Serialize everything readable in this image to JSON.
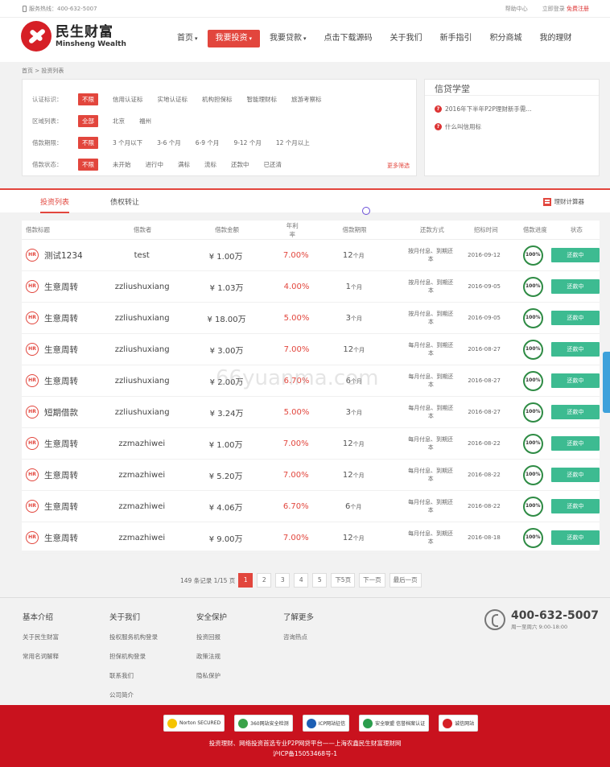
{
  "topbar": {
    "hotline": "服务热线：400-632-5007",
    "help": "帮助中心",
    "login": "立即登录",
    "register": "免费注册"
  },
  "logo": {
    "cn": "民生财富",
    "en": "Minsheng Wealth"
  },
  "nav": [
    {
      "label": "首页",
      "caret": "▾"
    },
    {
      "label": "我要投资",
      "caret": "▾"
    },
    {
      "label": "我要贷款",
      "caret": "▾"
    },
    {
      "label": "点击下载源码",
      "caret": ""
    },
    {
      "label": "关于我们",
      "caret": ""
    },
    {
      "label": "新手指引",
      "caret": ""
    },
    {
      "label": "积分商城",
      "caret": ""
    },
    {
      "label": "我的理财",
      "caret": ""
    }
  ],
  "breadcrumb": "首页 > 投资列表",
  "filters": [
    {
      "label": "认证标识：",
      "options": [
        "不限",
        "信用认证标",
        "实地认证标",
        "机构担保标",
        "智能理财标",
        "旅游考察标"
      ]
    },
    {
      "label": "区域列表：",
      "options": [
        "全部",
        "北京",
        "福州"
      ]
    },
    {
      "label": "借款期限：",
      "options": [
        "不限",
        "3 个月以下",
        "3-6 个月",
        "6-9 个月",
        "9-12 个月",
        "12 个月以上"
      ]
    },
    {
      "label": "借款状态：",
      "options": [
        "不限",
        "未开始",
        "进行中",
        "满标",
        "流标",
        "还款中",
        "已还清"
      ]
    }
  ],
  "more_filter": "更多筛选",
  "learn": {
    "title": "信贷学堂",
    "items": [
      "2016年下半年P2P理财新手需...",
      "什么叫信用标"
    ]
  },
  "tabs": {
    "active": "投资列表",
    "other": "债权转让",
    "calc": "理财计算器"
  },
  "table": {
    "headers": [
      "借款标题",
      "借款者",
      "借款金额",
      "年利率",
      "借款期限",
      "还款方式",
      "招标时间",
      "借款进度",
      "状态"
    ],
    "rows": [
      {
        "title": "测试1234",
        "borrower": "test",
        "amount": "¥ 1.00万",
        "rate": "7.00%",
        "period": "12",
        "unit": "个月",
        "repay": "按月付息、到期还本",
        "time": "2016-09-12",
        "progress": "100%",
        "status": "还款中"
      },
      {
        "title": "生意周转",
        "borrower": "zzliushuxiang",
        "amount": "¥ 1.03万",
        "rate": "4.00%",
        "period": "1",
        "unit": "个月",
        "repay": "按月付息、到期还本",
        "time": "2016-09-05",
        "progress": "100%",
        "status": "还款中"
      },
      {
        "title": "生意周转",
        "borrower": "zzliushuxiang",
        "amount": "¥ 18.00万",
        "rate": "5.00%",
        "period": "3",
        "unit": "个月",
        "repay": "按月付息、到期还本",
        "time": "2016-09-05",
        "progress": "100%",
        "status": "还款中"
      },
      {
        "title": "生意周转",
        "borrower": "zzliushuxiang",
        "amount": "¥ 3.00万",
        "rate": "7.00%",
        "period": "12",
        "unit": "个月",
        "repay": "每月付息、到期还本",
        "time": "2016-08-27",
        "progress": "100%",
        "status": "还款中"
      },
      {
        "title": "生意周转",
        "borrower": "zzliushuxiang",
        "amount": "¥ 2.00万",
        "rate": "6.70%",
        "period": "6",
        "unit": "个月",
        "repay": "每月付息、到期还本",
        "time": "2016-08-27",
        "progress": "100%",
        "status": "还款中"
      },
      {
        "title": "短期借款",
        "borrower": "zzliushuxiang",
        "amount": "¥ 3.24万",
        "rate": "5.00%",
        "period": "3",
        "unit": "个月",
        "repay": "每月付息、到期还本",
        "time": "2016-08-27",
        "progress": "100%",
        "status": "还款中"
      },
      {
        "title": "生意周转",
        "borrower": "zzmazhiwei",
        "amount": "¥ 1.00万",
        "rate": "7.00%",
        "period": "12",
        "unit": "个月",
        "repay": "每月付息、到期还本",
        "time": "2016-08-22",
        "progress": "100%",
        "status": "还款中"
      },
      {
        "title": "生意周转",
        "borrower": "zzmazhiwei",
        "amount": "¥ 5.20万",
        "rate": "7.00%",
        "period": "12",
        "unit": "个月",
        "repay": "每月付息、到期还本",
        "time": "2016-08-22",
        "progress": "100%",
        "status": "还款中"
      },
      {
        "title": "生意周转",
        "borrower": "zzmazhiwei",
        "amount": "¥ 4.06万",
        "rate": "6.70%",
        "period": "6",
        "unit": "个月",
        "repay": "每月付息、到期还本",
        "time": "2016-08-22",
        "progress": "100%",
        "status": "还款中"
      },
      {
        "title": "生意周转",
        "borrower": "zzmazhiwei",
        "amount": "¥ 9.00万",
        "rate": "7.00%",
        "period": "12",
        "unit": "个月",
        "repay": "每月付息、到期还本",
        "time": "2016-08-18",
        "progress": "100%",
        "status": "还款中"
      }
    ]
  },
  "pager": {
    "info": "149 条记录 1/15 页",
    "pages": [
      "1",
      "2",
      "3",
      "4",
      "5"
    ],
    "next5": "下5页",
    "next": "下一页",
    "last": "最后一页"
  },
  "footer": {
    "cols": [
      {
        "title": "基本介绍",
        "items": [
          "关于民生财富",
          "常用名词解释"
        ]
      },
      {
        "title": "关于我们",
        "items": [
          "投权服务机构登录",
          "担保机构登录",
          "联系我们",
          "公司简介"
        ]
      },
      {
        "title": "安全保护",
        "items": [
          "投资回报",
          "政策法规",
          "隐私保护"
        ]
      },
      {
        "title": "了解更多",
        "items": [
          "咨询热点"
        ]
      }
    ],
    "hotline": "400-632-5007",
    "hours": "周一至周六 9:00-18:00"
  },
  "badges": [
    "Norton SECURED",
    "360网站安全检测",
    "ICP网站征信",
    "安全联盟 信誉档案认证",
    "诚信网站"
  ],
  "bottom": {
    "line1": "投资理财、网络投资首选专业P2P网贷平台——上海农鑫民生财富理财网",
    "line2": "沪ICP备15053468号-1"
  },
  "watermark": "66yuanma.com",
  "colors": {
    "accent": "#e2463d",
    "status_green": "#3dbb91",
    "progress_green": "#2e8b44",
    "footer_red": "#c9121e"
  }
}
